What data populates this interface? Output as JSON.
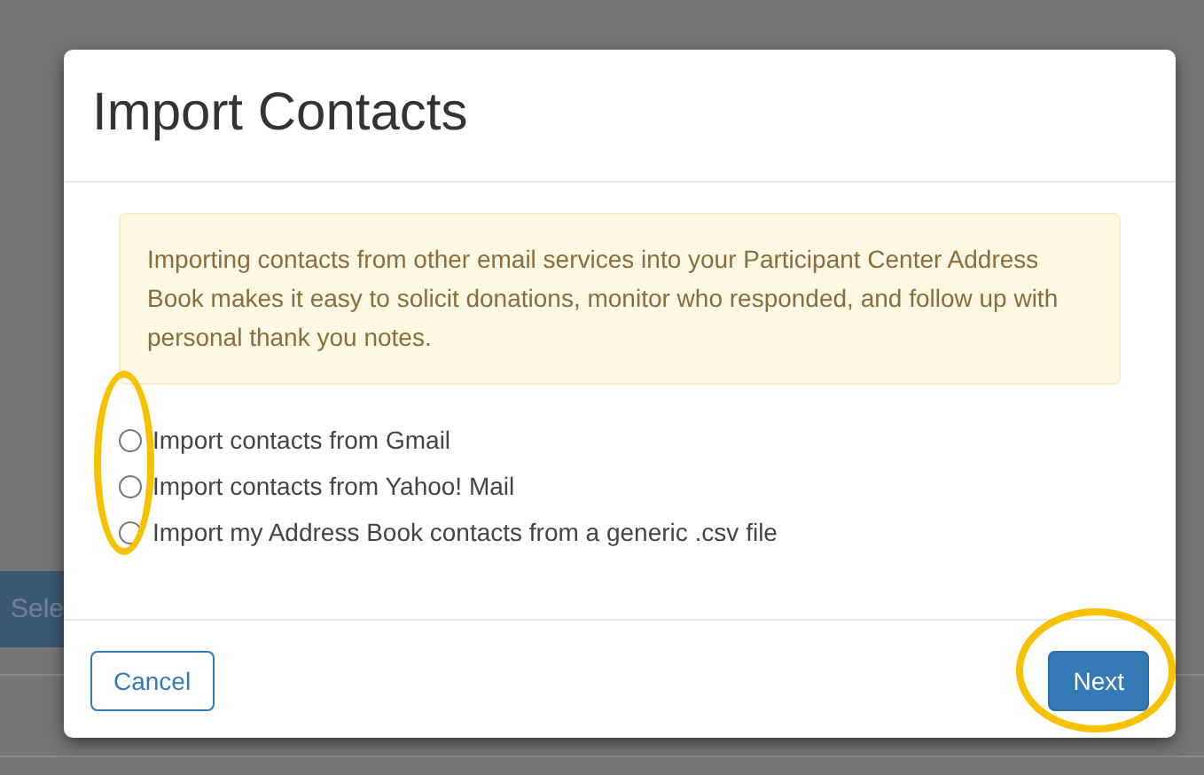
{
  "background": {
    "button_label": "Sele"
  },
  "dialog": {
    "title": "Import Contacts",
    "notice": "Importing contacts from other email services into your Participant Center Address Book makes it easy to solicit donations, monitor who responded, and follow up with personal thank you notes.",
    "options_highlighted": true,
    "options": [
      {
        "label": "Import contacts from Gmail",
        "selected": false
      },
      {
        "label": "Import contacts from Yahoo! Mail",
        "selected": false
      },
      {
        "label": "Import my Address Book contacts from a generic .csv file",
        "selected": false
      }
    ],
    "cancel_button": {
      "label": "Cancel"
    },
    "next_button": {
      "label": "Next",
      "highlighted": true
    }
  }
}
